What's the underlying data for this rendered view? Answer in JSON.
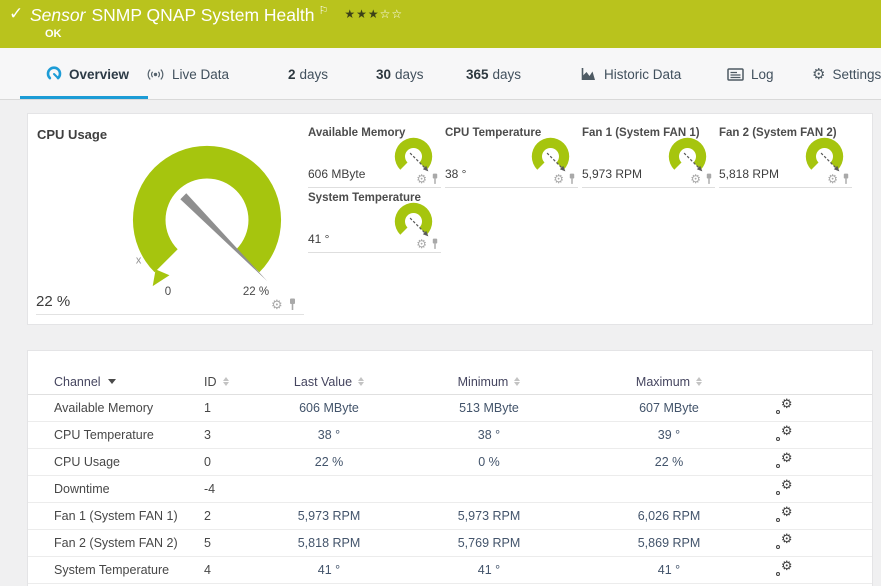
{
  "header": {
    "kicker": "Sensor",
    "title": "SNMP QNAP System Health",
    "status": "OK",
    "stars_filled": "★★★",
    "stars_empty": "☆☆",
    "rating": "3 of 5"
  },
  "tabs": [
    {
      "label": "Overview",
      "icon": "gauge-icon",
      "active": true
    },
    {
      "label": "Live Data",
      "icon": "live-icon"
    },
    {
      "bold": "2",
      "label": "days"
    },
    {
      "bold": "30",
      "label": "days"
    },
    {
      "bold": "365",
      "label": "days"
    },
    {
      "label": "Historic Data",
      "icon": "chart-icon"
    },
    {
      "label": "Log",
      "icon": "log-icon"
    },
    {
      "label": "Settings",
      "icon": "gear-icon"
    }
  ],
  "gauges": {
    "primary": {
      "title": "CPU Usage",
      "value": "22 %",
      "scale_min": "0",
      "scale_max": "22 %",
      "marker": "x"
    },
    "tiles": [
      {
        "title": "Available Memory",
        "value": "606 MByte"
      },
      {
        "title": "CPU Temperature",
        "value": "38 °"
      },
      {
        "title": "Fan 1 (System FAN 1)",
        "value": "5,973 RPM"
      },
      {
        "title": "Fan 2 (System FAN 2)",
        "value": "5,818 RPM"
      },
      {
        "title": "System Temperature",
        "value": "41 °"
      }
    ]
  },
  "table": {
    "columns": [
      "Channel",
      "ID",
      "Last Value",
      "Minimum",
      "Maximum"
    ],
    "rows": [
      [
        "Available Memory",
        "1",
        "606 MByte",
        "513 MByte",
        "607 MByte"
      ],
      [
        "CPU Temperature",
        "3",
        "38 °",
        "38 °",
        "39 °"
      ],
      [
        "CPU Usage",
        "0",
        "22 %",
        "0 %",
        "22 %"
      ],
      [
        "Downtime",
        "-4",
        "",
        "",
        ""
      ],
      [
        "Fan 1 (System FAN 1)",
        "2",
        "5,973 RPM",
        "5,973 RPM",
        "6,026 RPM"
      ],
      [
        "Fan 2 (System FAN 2)",
        "5",
        "5,818 RPM",
        "5,769 RPM",
        "5,869 RPM"
      ],
      [
        "System Temperature",
        "4",
        "41 °",
        "41 °",
        "41 °"
      ]
    ]
  },
  "colors": {
    "brand_green": "#b9c31d",
    "gauge_green": "#a6c50e",
    "accent_blue": "#1d9cd6",
    "status_ok": "OK"
  }
}
